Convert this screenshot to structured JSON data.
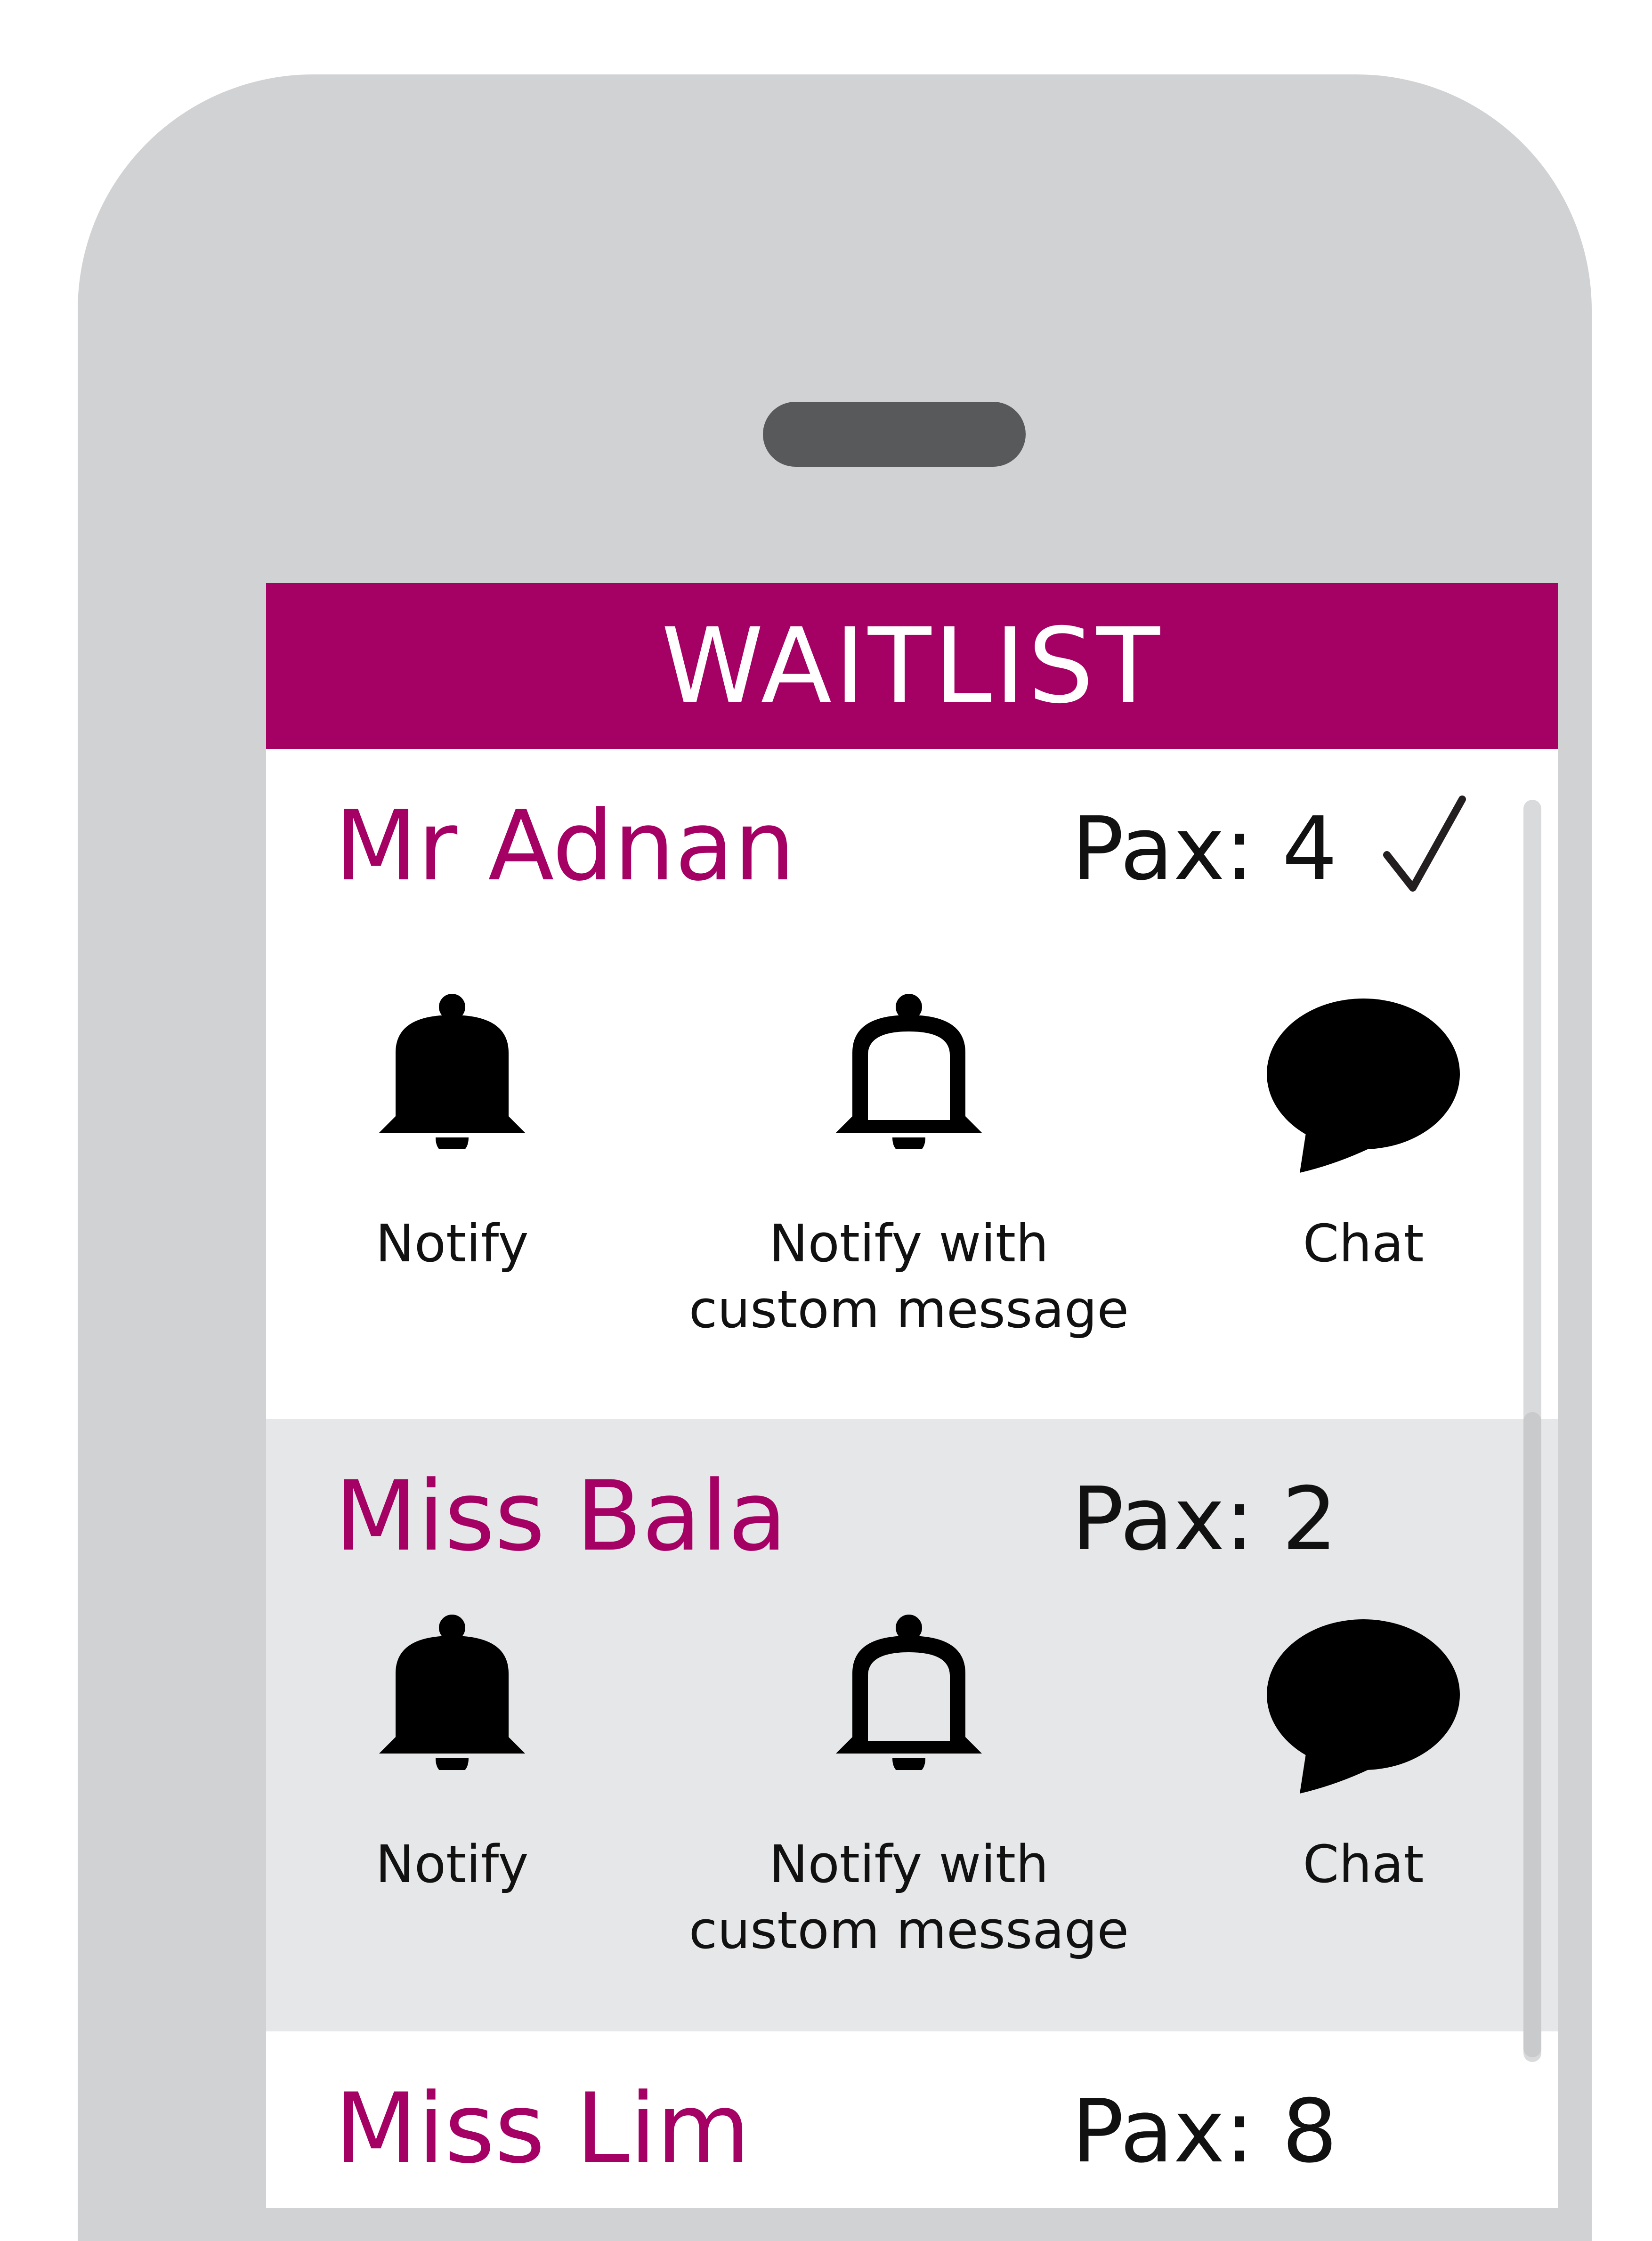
{
  "app": {
    "title": "WAITLIST",
    "brand_color": "#a50064"
  },
  "waitlist": [
    {
      "name": "Mr Adnan",
      "pax": "Pax: 4",
      "confirmed": true,
      "actions": {
        "notify": "Notify",
        "notify_custom": "Notify with\ncustom message",
        "chat": "Chat"
      }
    },
    {
      "name": "Miss Bala",
      "pax": "Pax: 2",
      "confirmed": false,
      "actions": {
        "notify": "Notify",
        "notify_custom": "Notify with\ncustom message",
        "chat": "Chat"
      }
    },
    {
      "name": "Miss Lim",
      "pax": "Pax: 8",
      "confirmed": false
    }
  ],
  "icons": {
    "notify": "bell-filled-icon",
    "notify_custom": "bell-outline-icon",
    "chat": "speech-bubble-icon",
    "confirmed": "checkmark-icon"
  }
}
